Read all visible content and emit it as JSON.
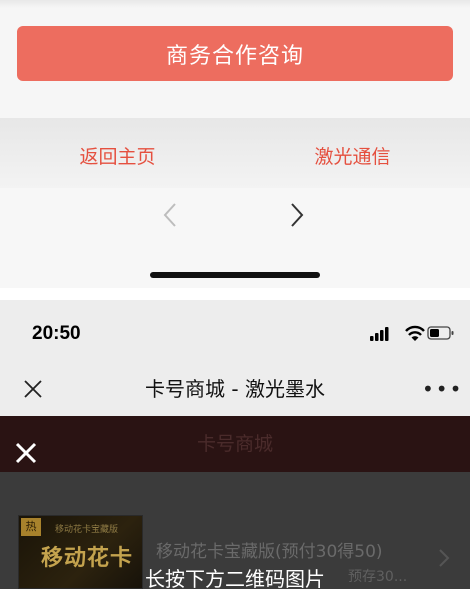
{
  "top": {
    "consult_button": "商务合作咨询",
    "links": [
      "返回主页",
      "激光通信"
    ]
  },
  "status_bar": {
    "time": "20:50"
  },
  "title_bar": {
    "title": "卡号商城 - 激光墨水"
  },
  "page": {
    "header": "卡号商城",
    "product": {
      "badge": "热",
      "image_small_text": "移动花卡宝藏版",
      "image_big_text": "移动花卡",
      "name": "移动花卡宝藏版(预付30得50)",
      "sub": "预存30..."
    }
  },
  "overlay": {
    "caption": "长按下方二维码图片"
  },
  "colors": {
    "accent": "#ed6d5f",
    "link": "#e5503f"
  }
}
